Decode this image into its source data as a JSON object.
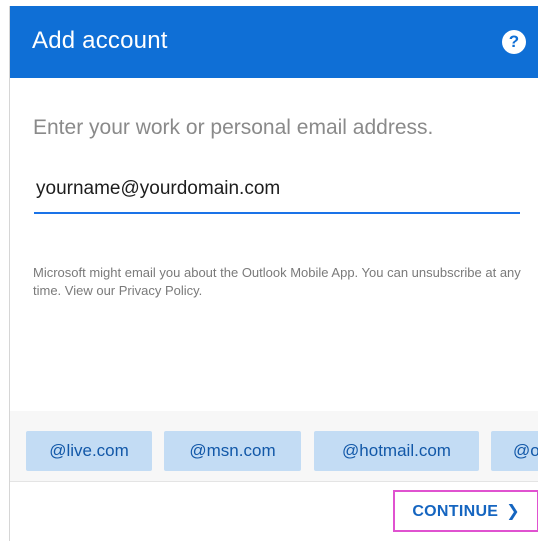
{
  "header": {
    "title": "Add account",
    "help_icon": "?"
  },
  "instruction": "Enter your work or personal email address.",
  "email_field": {
    "value": "yourname@yourdomain.com"
  },
  "disclaimer": "Microsoft might email you about the Outlook Mobile App. You can unsubscribe at any time. View our Privacy Policy.",
  "domains": [
    "@live.com",
    "@msn.com",
    "@hotmail.com",
    "@o"
  ],
  "footer": {
    "continue_label": "CONTINUE",
    "continue_icon": "❯"
  },
  "colors": {
    "header_bg": "#0f6fd6",
    "chip_bg": "#c3dcf4",
    "accent": "#1565c0",
    "highlight_border": "#e052d0"
  }
}
